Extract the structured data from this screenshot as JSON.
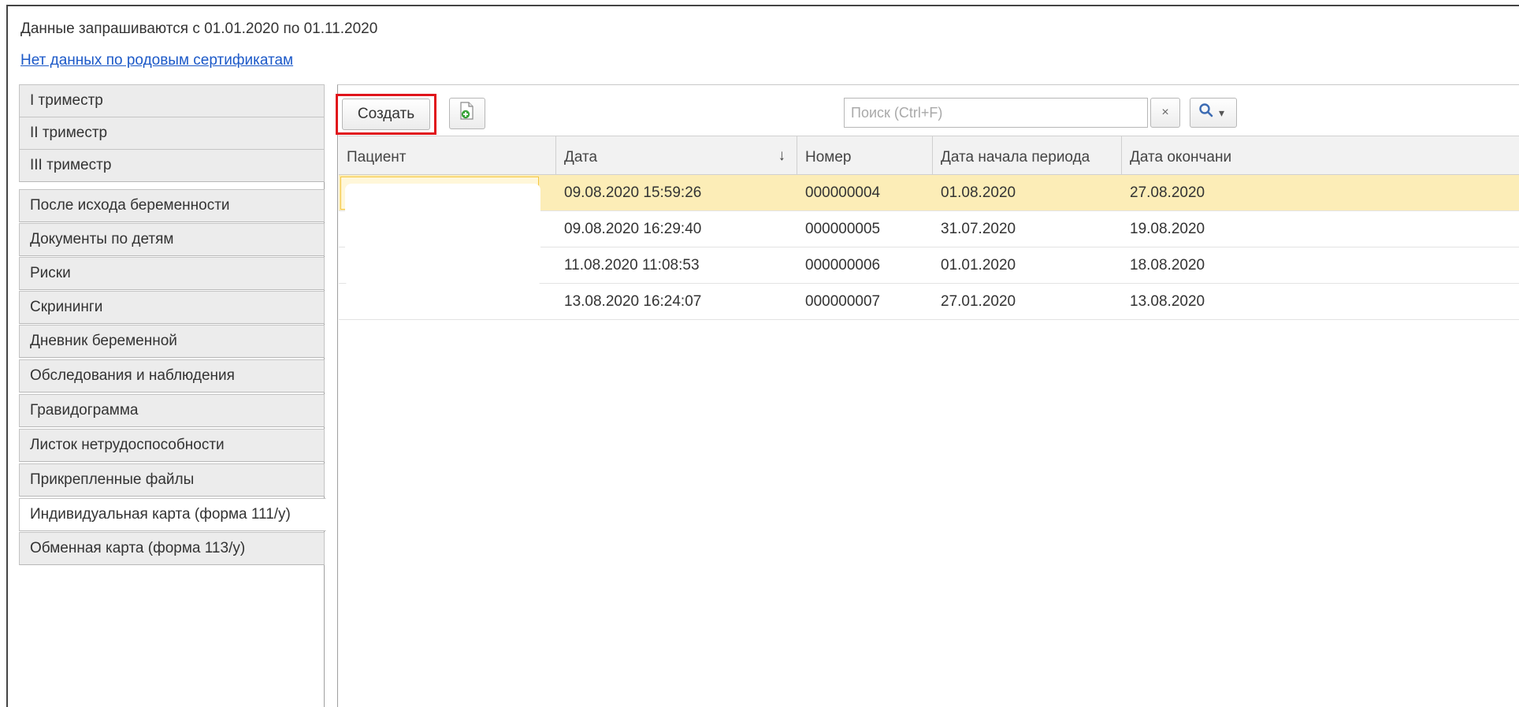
{
  "header": {
    "info_text": "Данные запрашиваются с 01.01.2020 по 01.11.2020",
    "cert_link": "Нет данных по родовым сертификатам"
  },
  "tabs": [
    {
      "label": "I триместр",
      "active": false
    },
    {
      "label": "II триместр",
      "active": false
    },
    {
      "label": "III триместр",
      "active": false
    },
    {
      "label": "После исхода беременности",
      "active": false
    },
    {
      "label": "Документы по детям",
      "active": false
    },
    {
      "label": "Риски",
      "active": false
    },
    {
      "label": "Скрининги",
      "active": false
    },
    {
      "label": "Дневник беременной",
      "active": false
    },
    {
      "label": "Обследования и наблюдения",
      "active": false
    },
    {
      "label": "Гравидограмма",
      "active": false
    },
    {
      "label": "Листок нетрудоспособности",
      "active": false
    },
    {
      "label": "Прикрепленные файлы",
      "active": false
    },
    {
      "label": "Индивидуальная карта (форма 111/у)",
      "active": true
    },
    {
      "label": "Обменная карта (форма 113/у)",
      "active": false
    }
  ],
  "toolbar": {
    "create_label": "Создать",
    "add_copy_icon": "add-document-icon",
    "search_placeholder": "Поиск (Ctrl+F)",
    "clear_label": "×",
    "search_icon": "magnifier-icon",
    "dropdown_glyph": "▾",
    "highlight_color": "#e0141b"
  },
  "table": {
    "columns": [
      {
        "label": "Пациент"
      },
      {
        "label": "Дата",
        "sort": "↓"
      },
      {
        "label": "Номер"
      },
      {
        "label": "Дата начала периода"
      },
      {
        "label": "Дата окончани"
      }
    ],
    "rows": [
      {
        "patient": "",
        "date": "09.08.2020 15:59:26",
        "number": "000000004",
        "start": "01.08.2020",
        "end": "27.08.2020",
        "selected": true
      },
      {
        "patient": "",
        "date": "09.08.2020 16:29:40",
        "number": "000000005",
        "start": "31.07.2020",
        "end": "19.08.2020",
        "selected": false
      },
      {
        "patient": "",
        "date": "11.08.2020 11:08:53",
        "number": "000000006",
        "start": "01.01.2020",
        "end": "18.08.2020",
        "selected": false
      },
      {
        "patient": "",
        "date": "13.08.2020 16:24:07",
        "number": "000000007",
        "start": "27.01.2020",
        "end": "13.08.2020",
        "selected": false
      }
    ],
    "selected_row_color": "#fcedb7"
  }
}
